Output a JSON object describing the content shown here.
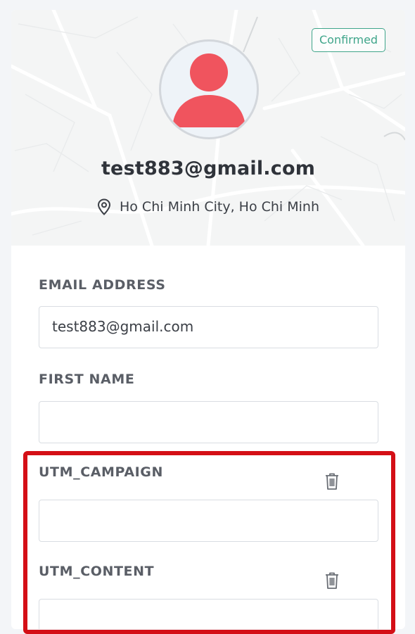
{
  "profile": {
    "status_badge": "Confirmed",
    "email": "test883@gmail.com",
    "location": "Ho Chi Minh City, Ho Chi Minh"
  },
  "form": {
    "email_label": "EMAIL ADDRESS",
    "email_value": "test883@gmail.com",
    "first_name_label": "FIRST NAME",
    "first_name_value": "",
    "utm_campaign_label": "UTM_CAMPAIGN",
    "utm_campaign_value": "",
    "utm_content_label": "UTM_CONTENT",
    "utm_content_value": ""
  },
  "icons": {
    "location": "map-pin-icon",
    "delete": "trash-icon",
    "avatar": "user-silhouette-icon"
  },
  "colors": {
    "badge": "#3fa58a",
    "avatar_figure": "#f0545e",
    "highlight_border": "#d40f16"
  }
}
